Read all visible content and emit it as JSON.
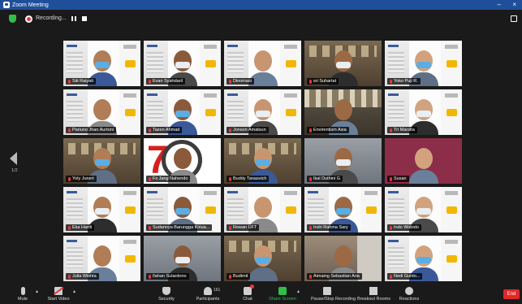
{
  "window": {
    "title": "Zoom Meeting",
    "minimize": "–",
    "close": "×"
  },
  "recording": {
    "label": "Recording..."
  },
  "gallery": {
    "page_label": "1/2",
    "tiles": [
      {
        "name": "Siti Raiyati",
        "style": "banner"
      },
      {
        "name": "Evan Syahdaril",
        "style": "banner"
      },
      {
        "name": "Dinomasi",
        "style": "banner"
      },
      {
        "name": "sri Suhartat",
        "style": "room"
      },
      {
        "name": "Yoko Puji R.",
        "style": "banner"
      },
      {
        "name": "Pariuno Jhan Aurtoni",
        "style": "banner"
      },
      {
        "name": "Tazen Ahmad",
        "style": "banner"
      },
      {
        "name": "Jonson Amatsun",
        "style": "banner"
      },
      {
        "name": "Envirentism Asia",
        "style": "hall"
      },
      {
        "name": "Tri Marsita",
        "style": "banner"
      },
      {
        "name": "Yoly Juneri",
        "style": "room"
      },
      {
        "name": "Fx Jang Nahendo",
        "style": "seventy"
      },
      {
        "name": "Buddy Tanasvich",
        "style": "room"
      },
      {
        "name": "Ikal Duthini G",
        "style": "office"
      },
      {
        "name": "Susan",
        "style": "pink"
      },
      {
        "name": "Eka Hardi",
        "style": "banner"
      },
      {
        "name": "Sudannya Barungga Kiriua...",
        "style": "banner"
      },
      {
        "name": "Rewan UFT",
        "style": "banner"
      },
      {
        "name": "Indri Rahma Sary",
        "style": "banner"
      },
      {
        "name": "Indo Widodo",
        "style": "banner"
      },
      {
        "name": "Julia Wishta",
        "style": "banner"
      },
      {
        "name": "Ilahan Sulardono",
        "style": "office"
      },
      {
        "name": "Budimit",
        "style": "room"
      },
      {
        "name": "Aimaing Sebastian Aria",
        "style": "home"
      },
      {
        "name": "Nedi Gunto...",
        "style": "banner"
      }
    ]
  },
  "toolbar": {
    "mute": "Mute",
    "start_video": "Start Video",
    "security": "Security",
    "participants": "Participants",
    "participants_count": "161",
    "chat": "Chat",
    "share_screen": "Share Screen",
    "pause_recording": "Pause/Stop Recording",
    "breakout_rooms": "Breakout Rooms",
    "reactions": "Reactions",
    "end": "End"
  },
  "colors": {
    "titlebar": "#1f4f9a",
    "accent_green": "#2fbf4a",
    "end_red": "#e02828",
    "muted_red": "#e23a3a"
  }
}
